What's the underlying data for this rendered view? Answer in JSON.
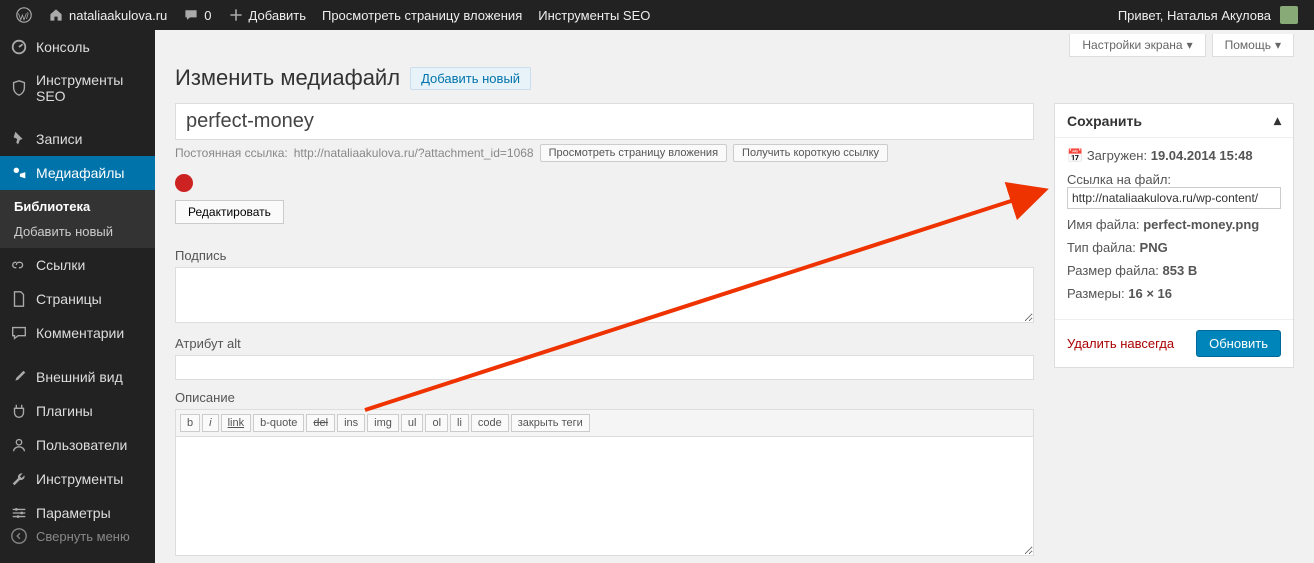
{
  "adminbar": {
    "site_name": "nataliaakulova.ru",
    "comments_count": "0",
    "add_new": "Добавить",
    "view_attachment": "Просмотреть страницу вложения",
    "seo_tools": "Инструменты SEO",
    "greeting": "Привет, Наталья Акулова"
  },
  "sidebar": {
    "dashboard": "Консоль",
    "seo_tools": "Инструменты SEO",
    "posts": "Записи",
    "media": "Медиафайлы",
    "media_sub_library": "Библиотека",
    "media_sub_addnew": "Добавить новый",
    "links": "Ссылки",
    "pages": "Страницы",
    "comments": "Комментарии",
    "appearance": "Внешний вид",
    "plugins": "Плагины",
    "users": "Пользователи",
    "tools": "Инструменты",
    "settings": "Параметры",
    "collapse": "Свернуть меню"
  },
  "screen_tabs": {
    "screen_options": "Настройки экрана",
    "help": "Помощь"
  },
  "page": {
    "title": "Изменить медиафайл",
    "add_new": "Добавить новый",
    "post_title": "perfect-money",
    "permalink_label": "Постоянная ссылка:",
    "permalink_url": "http://nataliaakulova.ru/?attachment_id=1068",
    "btn_view": "Просмотреть страницу вложения",
    "btn_shortlink": "Получить короткую ссылку",
    "edit_image": "Редактировать",
    "caption_label": "Подпись",
    "alt_label": "Атрибут alt",
    "desc_label": "Описание",
    "qt": {
      "b": "b",
      "i": "i",
      "link": "link",
      "bquote": "b-quote",
      "del": "del",
      "ins": "ins",
      "img": "img",
      "ul": "ul",
      "ol": "ol",
      "li": "li",
      "code": "code",
      "close": "закрыть теги"
    }
  },
  "savebox": {
    "title": "Сохранить",
    "uploaded_label": "Загружен:",
    "uploaded_value": "19.04.2014 15:48",
    "file_url_label": "Ссылка на файл:",
    "file_url": "http://nataliaakulova.ru/wp-content/",
    "filename_label": "Имя файла:",
    "filename_value": "perfect-money.png",
    "filetype_label": "Тип файла:",
    "filetype_value": "PNG",
    "filesize_label": "Размер файла:",
    "filesize_value": "853 B",
    "dimensions_label": "Размеры:",
    "dimensions_value": "16 × 16",
    "delete": "Удалить навсегда",
    "update": "Обновить"
  }
}
